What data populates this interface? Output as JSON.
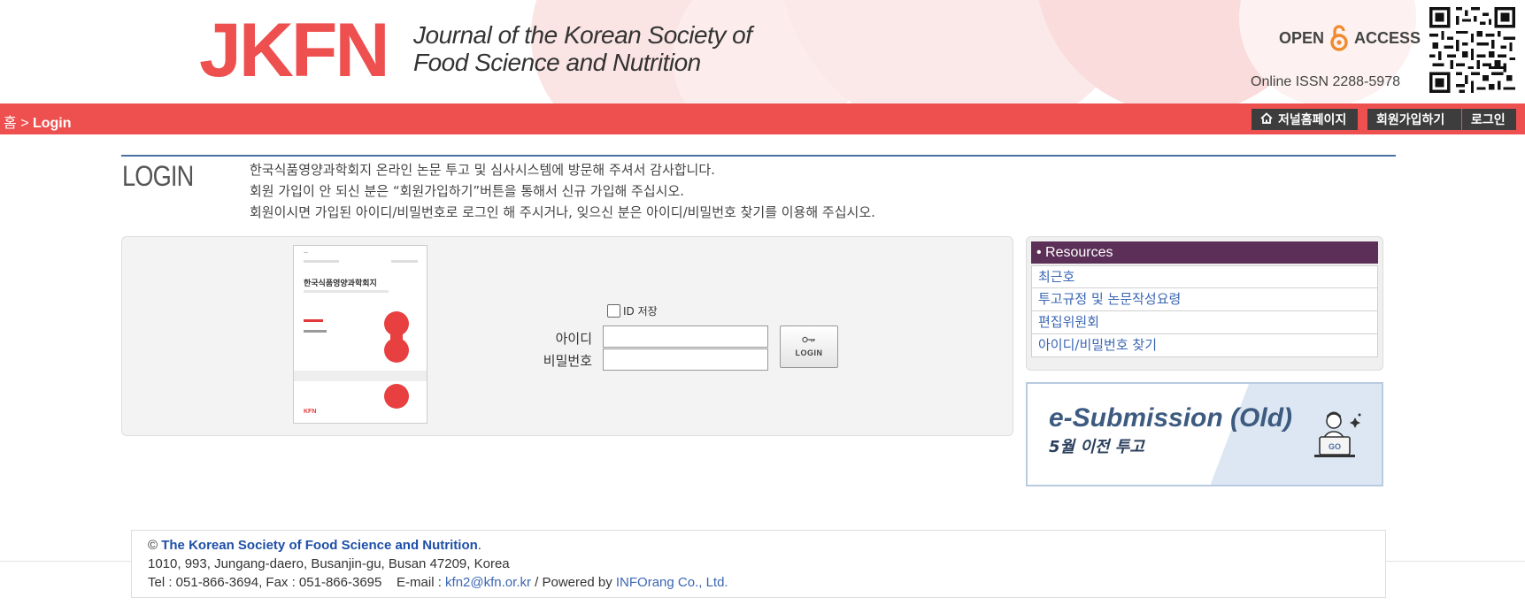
{
  "colors": {
    "brand_red": "#ee5050",
    "nav_button_bg": "#3d3d3d",
    "resources_header_bg": "#5b2f57",
    "link_blue": "#3a66b3",
    "accent_blue": "#4a6fa5"
  },
  "header": {
    "logo_text": "JKFN",
    "journal_title_line1": "Journal of the Korean Society of",
    "journal_title_line2": "Food Science and Nutrition",
    "open_access_left": "OPEN",
    "open_access_right": "ACCESS",
    "open_access_icon": "open-access-lock-icon",
    "issn": "Online ISSN 2288-5978",
    "qr_icon": "qr-code-icon"
  },
  "nav": {
    "breadcrumb_home": "홈",
    "breadcrumb_sep": ">",
    "breadcrumb_current": "Login",
    "buttons": {
      "journal_home": "저널홈페이지",
      "journal_home_icon": "home-icon",
      "signup": "회원가입하기",
      "login": "로그인"
    }
  },
  "login": {
    "heading": "LOGIN",
    "intro_line1": "한국식품영양과학회지 온라인 논문 투고 및 심사시스템에 방문해 주셔서 감사합니다.",
    "intro_line2": "회원 가입이 안 되신 분은 “회원가입하기”버튼을 통해서 신규 가입해 주십시오.",
    "intro_line3": "회원이시면 가입된 아이디/비밀번호로 로그인 해 주시거나, 잊으신 분은 아이디/비밀번호 찾기를 이용해 주십시오.",
    "save_id_label": "ID 저장",
    "id_label": "아이디",
    "id_value": "",
    "password_label": "비밀번호",
    "password_value": "",
    "login_button_label": "LOGIN",
    "login_button_icon": "key-icon",
    "cover": {
      "title": "한국식품영양과학회지",
      "logo": "KFN"
    }
  },
  "resources": {
    "header": "• Resources",
    "items": [
      {
        "label": "최근호"
      },
      {
        "label": "투고규정 및 논문작성요령"
      },
      {
        "label": "편집위원회"
      },
      {
        "label": "아이디/비밀번호 찾기"
      }
    ]
  },
  "esubmission": {
    "title": "e-Submission (Old)",
    "subtitle": "5월 이전 투고",
    "go_label": "GO",
    "icon": "person-laptop-icon"
  },
  "footer": {
    "copyright_symbol": "©",
    "org_name": "The Korean Society of Food Science and Nutrition",
    "org_suffix": ".",
    "address": "1010, 993, Jungang-daero, Busanjin-gu, Busan 47209, Korea",
    "tel_fax": "Tel : 051-866-3694, Fax : 051-866-3695",
    "email_label": "E-mail :",
    "email": "kfn2@kfn.or.kr",
    "powered_sep": "/ Powered by",
    "powered_by": "INFOrang Co., Ltd."
  }
}
